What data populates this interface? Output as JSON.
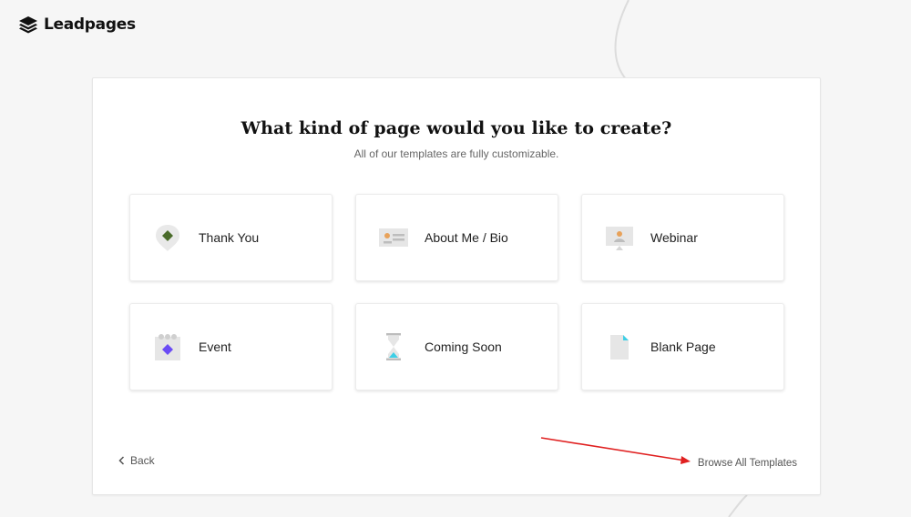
{
  "app": {
    "logo_text": "Leadpages"
  },
  "main": {
    "heading": "What kind of page would you like to create?",
    "subheading": "All of our templates are fully customizable."
  },
  "templates": [
    {
      "label": "Thank You",
      "icon": "map-pin-icon"
    },
    {
      "label": "About Me / Bio",
      "icon": "profile-card-icon"
    },
    {
      "label": "Webinar",
      "icon": "presentation-screen-icon"
    },
    {
      "label": "Event",
      "icon": "calendar-icon"
    },
    {
      "label": "Coming Soon",
      "icon": "hourglass-icon"
    },
    {
      "label": "Blank Page",
      "icon": "blank-document-icon"
    }
  ],
  "footer": {
    "back_label": "Back",
    "browse_label": "Browse All Templates"
  },
  "colors": {
    "accent_green": "#4a6b2a",
    "accent_purple": "#6b4cf5",
    "accent_cyan": "#3ecfe6",
    "accent_orange": "#e8a25a",
    "annotation_red": "#e02020"
  }
}
